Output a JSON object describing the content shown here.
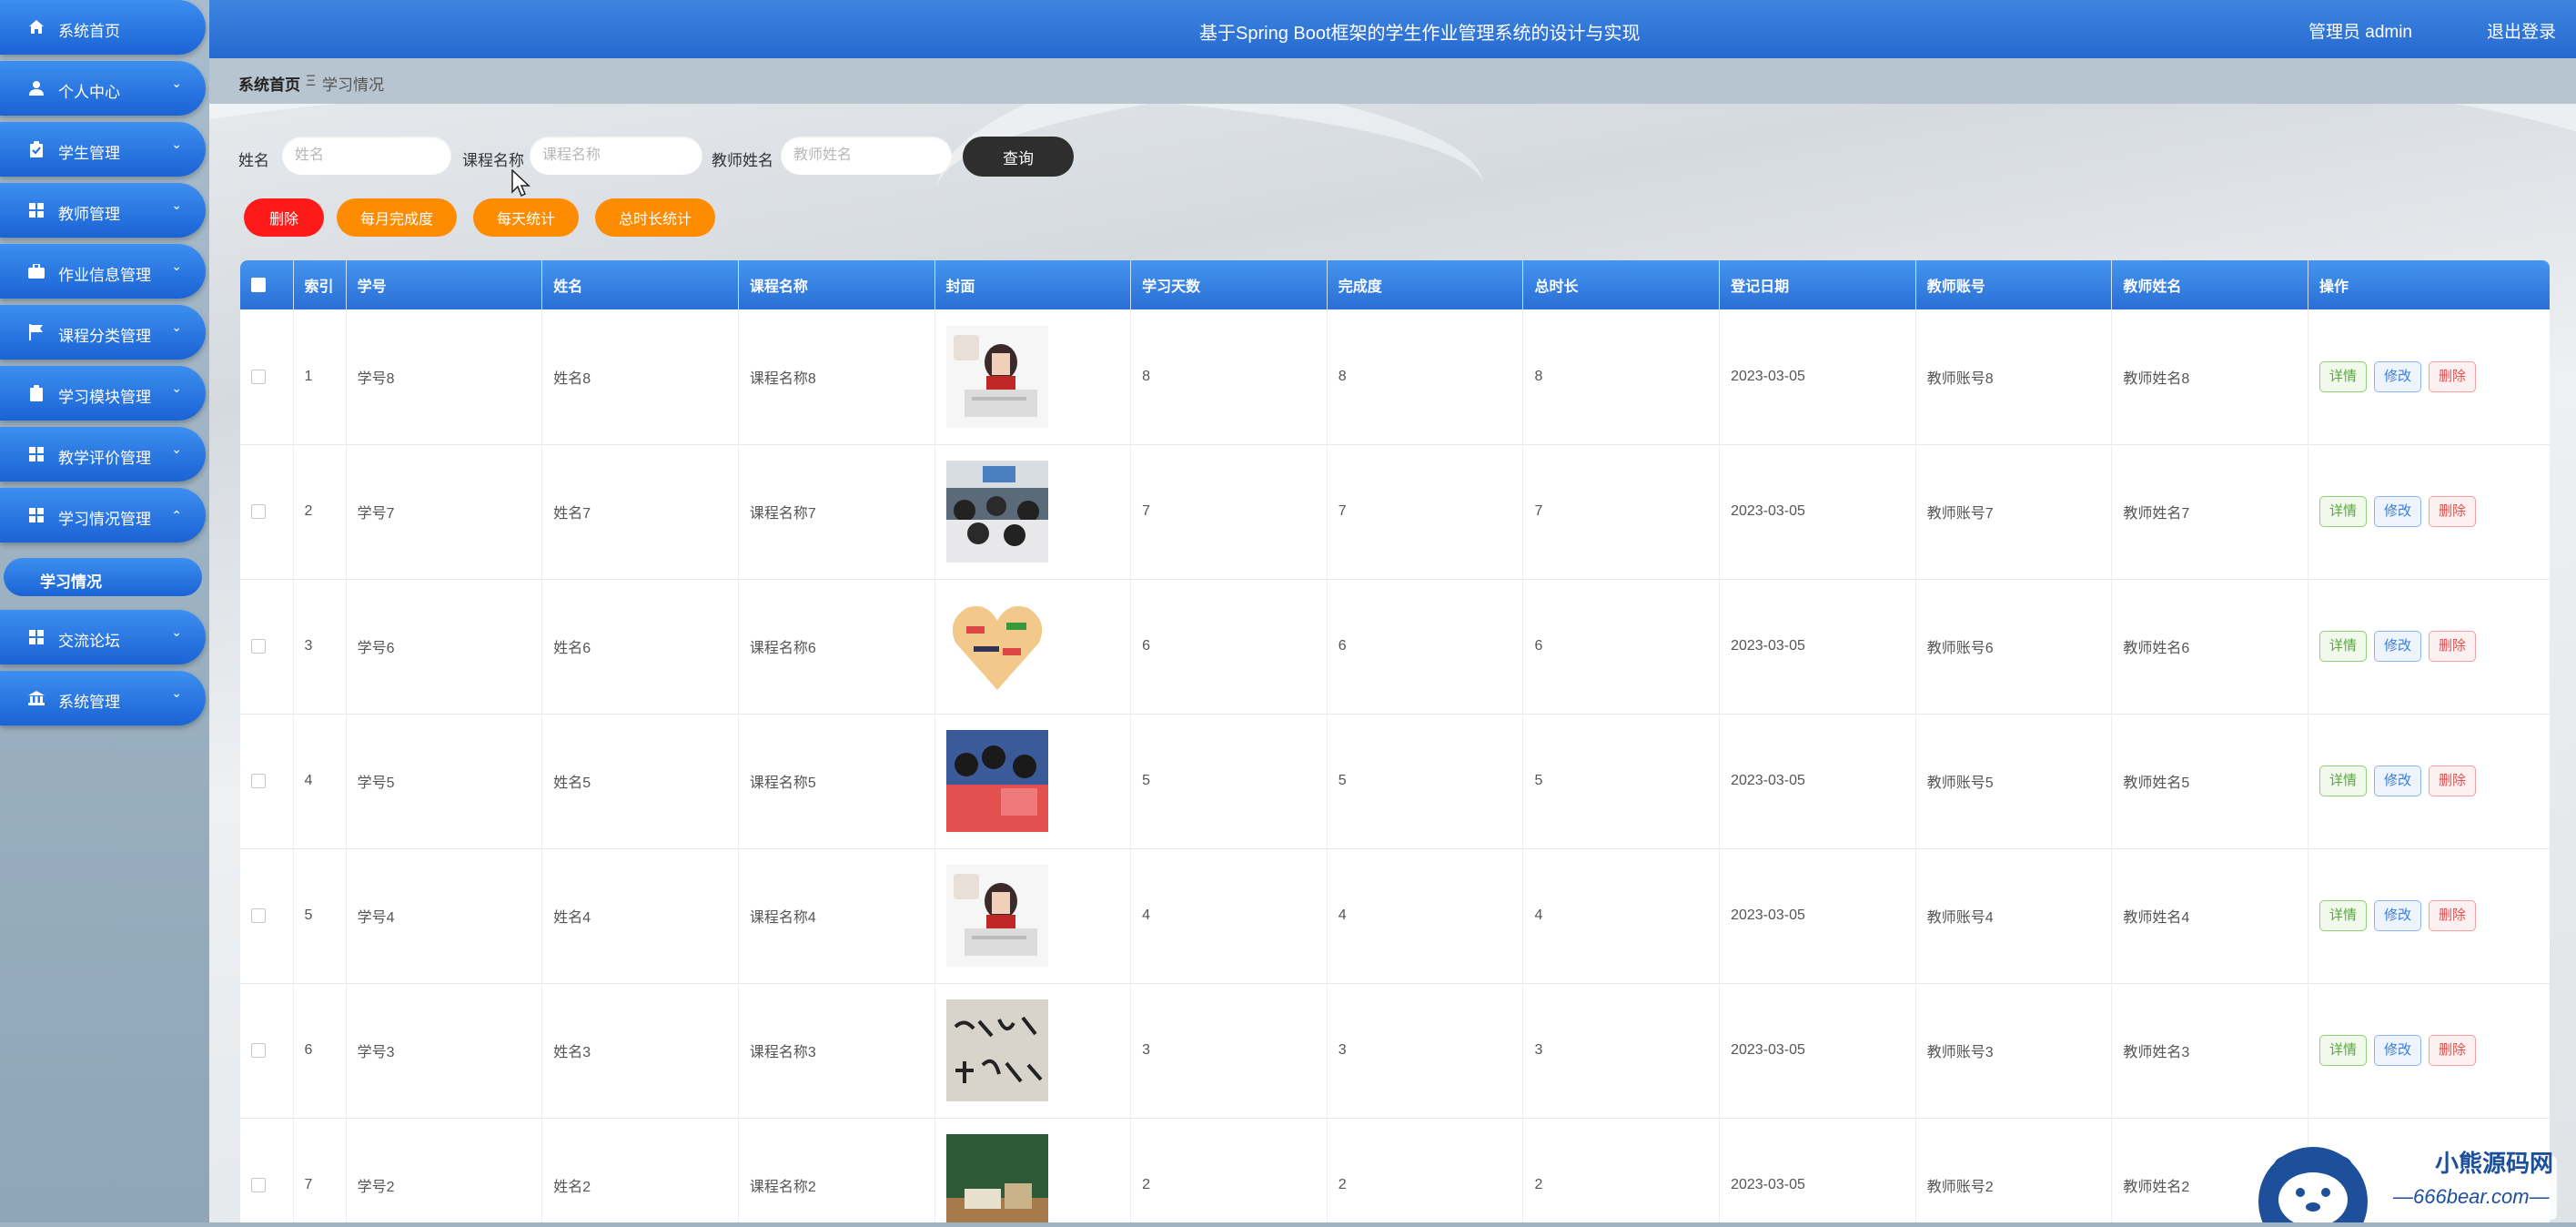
{
  "header": {
    "title": "基于Spring Boot框架的学生作业管理系统的设计与实现",
    "admin_label": "管理员 admin",
    "logout": "退出登录"
  },
  "sidebar": {
    "items": [
      {
        "label": "系统首页",
        "icon": "home-icon"
      },
      {
        "label": "个人中心",
        "icon": "user-icon"
      },
      {
        "label": "学生管理",
        "icon": "clipboard-icon"
      },
      {
        "label": "教师管理",
        "icon": "grid-icon"
      },
      {
        "label": "作业信息管理",
        "icon": "briefcase-icon"
      },
      {
        "label": "课程分类管理",
        "icon": "flag-icon"
      },
      {
        "label": "学习模块管理",
        "icon": "clipboard-icon"
      },
      {
        "label": "教学评价管理",
        "icon": "grid-icon"
      },
      {
        "label": "学习情况管理",
        "icon": "grid-icon"
      },
      {
        "label": "交流论坛",
        "icon": "grid-icon"
      },
      {
        "label": "系统管理",
        "icon": "bank-icon"
      }
    ],
    "sub_item": "学习情况"
  },
  "breadcrumb": {
    "home": "系统首页",
    "separator": "Ξ",
    "current": "学习情况"
  },
  "search": {
    "name_label": "姓名",
    "name_placeholder": "姓名",
    "course_label": "课程名称",
    "course_placeholder": "课程名称",
    "teacher_label": "教师姓名",
    "teacher_placeholder": "教师姓名",
    "query_button": "查询"
  },
  "actions": {
    "delete": "删除",
    "monthly": "每月完成度",
    "daily": "每天统计",
    "total": "总时长统计"
  },
  "table": {
    "headers": [
      "索引",
      "学号",
      "姓名",
      "课程名称",
      "封面",
      "学习天数",
      "完成度",
      "总时长",
      "登记日期",
      "教师账号",
      "教师姓名",
      "操作"
    ],
    "op_labels": {
      "detail": "详情",
      "edit": "修改",
      "delete": "删除"
    },
    "rows": [
      {
        "index": "1",
        "student_no": "学号8",
        "name": "姓名8",
        "course": "课程名称8",
        "days": "8",
        "completion": "8",
        "duration": "8",
        "date": "2023-03-05",
        "teacher_account": "教师账号8",
        "teacher_name": "教师姓名8"
      },
      {
        "index": "2",
        "student_no": "学号7",
        "name": "姓名7",
        "course": "课程名称7",
        "days": "7",
        "completion": "7",
        "duration": "7",
        "date": "2023-03-05",
        "teacher_account": "教师账号7",
        "teacher_name": "教师姓名7"
      },
      {
        "index": "3",
        "student_no": "学号6",
        "name": "姓名6",
        "course": "课程名称6",
        "days": "6",
        "completion": "6",
        "duration": "6",
        "date": "2023-03-05",
        "teacher_account": "教师账号6",
        "teacher_name": "教师姓名6"
      },
      {
        "index": "4",
        "student_no": "学号5",
        "name": "姓名5",
        "course": "课程名称5",
        "days": "5",
        "completion": "5",
        "duration": "5",
        "date": "2023-03-05",
        "teacher_account": "教师账号5",
        "teacher_name": "教师姓名5"
      },
      {
        "index": "5",
        "student_no": "学号4",
        "name": "姓名4",
        "course": "课程名称4",
        "days": "4",
        "completion": "4",
        "duration": "4",
        "date": "2023-03-05",
        "teacher_account": "教师账号4",
        "teacher_name": "教师姓名4"
      },
      {
        "index": "6",
        "student_no": "学号3",
        "name": "姓名3",
        "course": "课程名称3",
        "days": "3",
        "completion": "3",
        "duration": "3",
        "date": "2023-03-05",
        "teacher_account": "教师账号3",
        "teacher_name": "教师姓名3"
      },
      {
        "index": "7",
        "student_no": "学号2",
        "name": "姓名2",
        "course": "课程名称2",
        "days": "2",
        "completion": "2",
        "duration": "2",
        "date": "2023-03-05",
        "teacher_account": "教师账号2",
        "teacher_name": "教师姓名2"
      }
    ]
  },
  "watermark": {
    "title": "小熊源码网",
    "url": "—666bear.com—"
  },
  "colors": {
    "accent": "#2a6fd6",
    "delete_btn": "#ff1a1a",
    "orange_btn": "#ff8c00",
    "query_btn": "#2e2e2e"
  }
}
